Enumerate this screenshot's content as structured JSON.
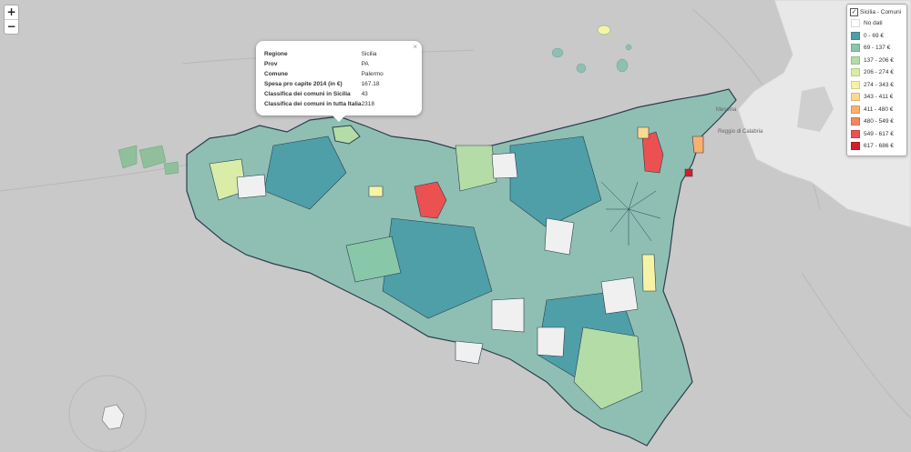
{
  "map": {
    "island_color": "#8fbfb3",
    "sea_color": "#c9c9c9"
  },
  "zoom": {
    "in_label": "+",
    "out_label": "−"
  },
  "popup": {
    "close_label": "×",
    "rows": [
      {
        "key": "Regione",
        "value": "Sicilia"
      },
      {
        "key": "Prov",
        "value": "PA"
      },
      {
        "key": "Comune",
        "value": "Palermo"
      },
      {
        "key": "Spesa pro capite 2014 (in €)",
        "value": "167.18"
      },
      {
        "key": "Classifica dei comuni in Sicilia",
        "value": "43"
      },
      {
        "key": "Classifica dei comuni in tutta Italia",
        "value": "2318"
      }
    ]
  },
  "legend": {
    "layer_label": "Sicilia - Comuni",
    "layer_checked": true,
    "check_mark": "✓",
    "items": [
      {
        "label": "No dati",
        "color": "#ffffff"
      },
      {
        "label": "0 - 69 €",
        "color": "#4e9fa8"
      },
      {
        "label": "69 - 137 €",
        "color": "#88c8a8"
      },
      {
        "label": "137 - 206 €",
        "color": "#b3dca6"
      },
      {
        "label": "206 - 274 €",
        "color": "#d9eda8"
      },
      {
        "label": "274 - 343 €",
        "color": "#f7f3a5"
      },
      {
        "label": "343 - 411 €",
        "color": "#fbd98f"
      },
      {
        "label": "411 - 480 €",
        "color": "#f9b06f"
      },
      {
        "label": "480 - 549 €",
        "color": "#f48760"
      },
      {
        "label": "549 - 617 €",
        "color": "#ea5150"
      },
      {
        "label": "617 - 686 €",
        "color": "#d11f2a"
      }
    ]
  }
}
